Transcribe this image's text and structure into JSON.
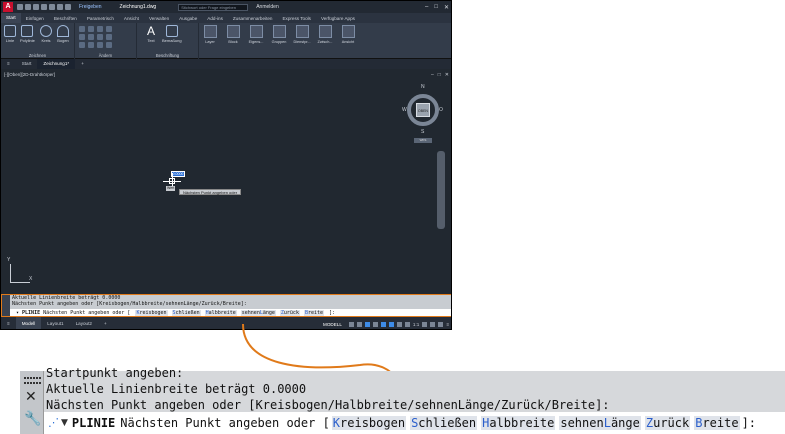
{
  "titlebar": {
    "logo": "A",
    "share": "Freigeben",
    "doc_title": "Zeichnung1.dwg",
    "search_placeholder": "Stichwort oder Frage eingeben",
    "user": "Anmelden"
  },
  "ribbon_tabs": [
    "Start",
    "Einfügen",
    "Beschriften",
    "Parametrisch",
    "Ansicht",
    "Verwalten",
    "Ausgabe",
    "Add-ins",
    "Zusammenarbeiten",
    "Express Tools",
    "Verfügbare Apps"
  ],
  "ribbon": {
    "zeichnen": {
      "tools": [
        "Linie",
        "Polylinie",
        "Kreis",
        "Bogen"
      ],
      "label": "Zeichnen"
    },
    "aendern": {
      "label": "Ändern"
    },
    "beschriftung": {
      "tools": [
        "Text",
        "Bemaßung"
      ],
      "label": "Beschriftung"
    },
    "big": [
      "Layer",
      "Block",
      "Eigens...",
      "Gruppen",
      "Dienstpr...",
      "Zwisch...",
      "Ansicht"
    ]
  },
  "file_tabs": [
    "Start",
    "Zeichnung1*"
  ],
  "viewport": {
    "label": "[-][Oben][2D-Drahtkörper]",
    "viewcube": {
      "n": "N",
      "s": "S",
      "w": "W",
      "o": "O",
      "face": "OBEN",
      "wks": "WKS"
    },
    "input_value": "0.0000",
    "tooltip": "Nächsten Punkt angeben oder",
    "small_tip": "Wert",
    "ucs_x": "X",
    "ucs_y": "Y"
  },
  "command_line": {
    "history_partial": "Startpunkt angeben:",
    "history": [
      "Aktuelle Linienbreite beträgt 0.0000",
      "Nächsten Punkt angeben oder [Kreisbogen/Halbbreite/sehnenLänge/Zurück/Breite]:"
    ],
    "command": "PLINIE",
    "prompt": "Nächsten Punkt angeben oder [",
    "options": [
      {
        "key": "K",
        "rest": "reisbogen",
        "pre": ""
      },
      {
        "key": "S",
        "rest": "chließen",
        "pre": ""
      },
      {
        "key": "H",
        "rest": "albbreite",
        "pre": ""
      },
      {
        "key": "L",
        "rest": "änge",
        "pre": "sehnen"
      },
      {
        "key": "Z",
        "rest": "urück",
        "pre": ""
      },
      {
        "key": "B",
        "rest": "reite",
        "pre": ""
      }
    ],
    "suffix": "]:"
  },
  "statusbar": {
    "layouts": [
      "Modell",
      "Layout1",
      "Layout2"
    ],
    "model": "MODELL",
    "scale": "1:1"
  },
  "colors": {
    "highlight": "#e07a1a",
    "option_key": "#2b5fcc"
  }
}
